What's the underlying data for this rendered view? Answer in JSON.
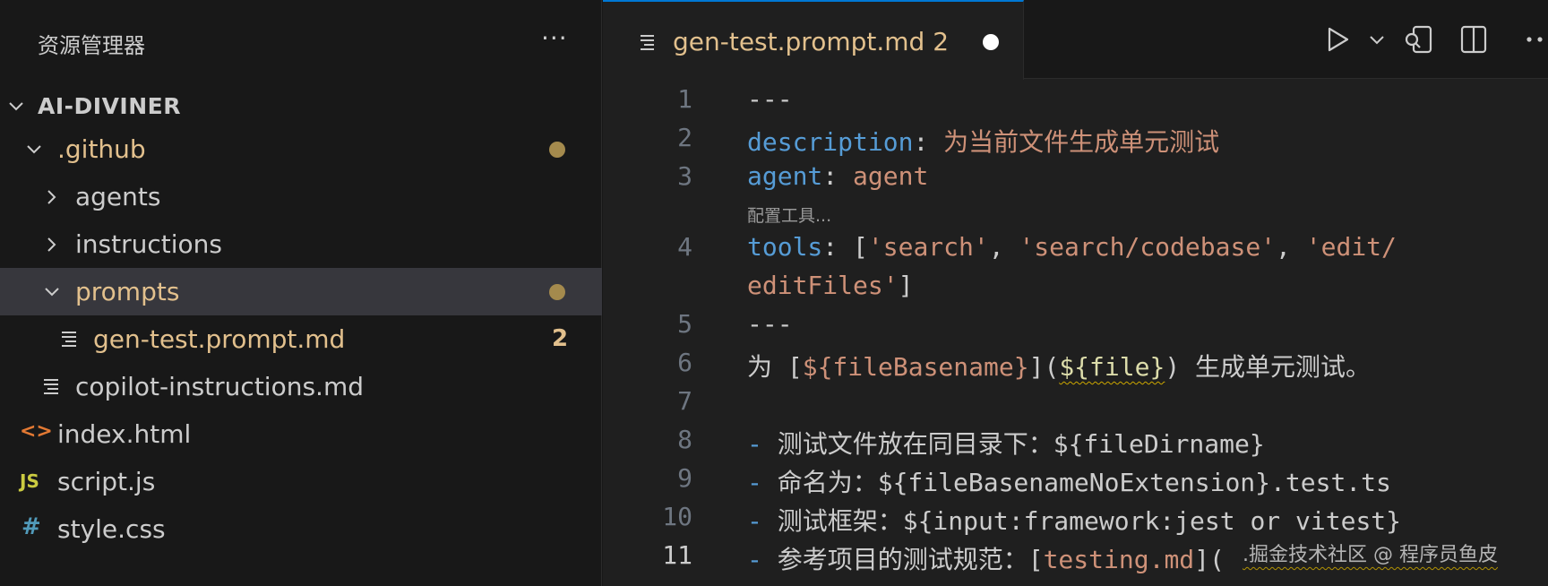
{
  "sidebar": {
    "title": "资源管理器",
    "more": "···",
    "root": "AI-DIVINER",
    "items": [
      {
        "label": ".github",
        "badge": ""
      },
      {
        "label": "agents"
      },
      {
        "label": "instructions"
      },
      {
        "label": "prompts"
      },
      {
        "label": "gen-test.prompt.md",
        "badge": "2"
      },
      {
        "label": "copilot-instructions.md"
      },
      {
        "label": "index.html",
        "icon_text": "<>"
      },
      {
        "label": "script.js",
        "icon_text": "JS"
      },
      {
        "label": "style.css",
        "icon_text": "#"
      }
    ]
  },
  "tab": {
    "label": "gen-test.prompt.md  2",
    "dirty": true
  },
  "editor": {
    "line_numbers": [
      "1",
      "2",
      "3",
      "4",
      "5",
      "6",
      "7",
      "8",
      "9",
      "10",
      "11"
    ],
    "codelens": "配置工具...",
    "lines": {
      "l1": "---",
      "l2_key": "description",
      "l2_colon": ": ",
      "l2_val": "为当前文件生成单元测试",
      "l3_key": "agent",
      "l3_colon": ": ",
      "l3_val": "agent",
      "l4_key": "tools",
      "l4_rest_a": ": [",
      "l4_s1": "'search'",
      "l4_c1": ", ",
      "l4_s2": "'search/codebase'",
      "l4_c2": ", ",
      "l4_s3a": "'edit/",
      "l4_s3b": "editFiles'",
      "l4_end": "]",
      "l5": "---",
      "l6_a": "为 [",
      "l6_b": "${fileBasename}",
      "l6_c": "](",
      "l6_d": "${file}",
      "l6_e": ") 生成单元测试。",
      "l8_dash": "- ",
      "l8_text": "测试文件放在同目录下：${fileDirname}",
      "l9_dash": "- ",
      "l9_text": "命名为：${fileBasenameNoExtension}.test.ts",
      "l10_dash": "- ",
      "l10_text": "测试框架：${input:framework:jest or vitest}",
      "l11_dash": "- ",
      "l11_text": "参考项目的测试规范：[",
      "l11_link": "testing.md",
      "l11_end": "]("
    },
    "watermark": ".掘金技术社区 @ 程序员鱼皮"
  },
  "colors": {
    "accent": "#0078d4",
    "modified": "#e2c08d",
    "keyword": "#569cd6",
    "string": "#ce9178"
  }
}
